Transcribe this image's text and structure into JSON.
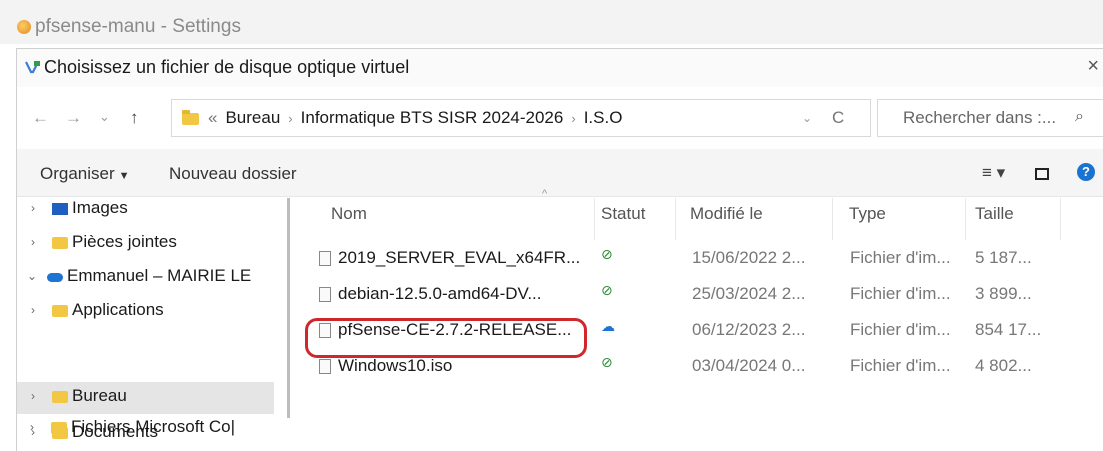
{
  "background_window": {
    "title": "pfsense-manu - Settings",
    "icon": "virtualbox-icon"
  },
  "dialog": {
    "title": "Choisissez un fichier de disque optique virtuel",
    "close": "×"
  },
  "navigation": {
    "back": "←",
    "forward": "→",
    "recent": "⌄",
    "up": "↑"
  },
  "address": {
    "overflow": "«",
    "crumbs": [
      "Bureau",
      "Informatique BTS SISR 2024-2026",
      "I.S.O"
    ],
    "separator": "›",
    "dropdown": "⌄",
    "refresh": "C"
  },
  "search": {
    "placeholder": "Rechercher dans :...",
    "icon": "search-icon"
  },
  "toolbar": {
    "organize": "Organiser",
    "new_folder": "Nouveau dossier",
    "view": "≡ ▾",
    "help": "?"
  },
  "nav_pane": {
    "items": [
      {
        "label": "Images",
        "chevron": "›",
        "icon": "images-icon"
      },
      {
        "label": "Pièces jointes",
        "chevron": "›",
        "icon": "folder-icon"
      },
      {
        "label": "Emmanuel – MAIRIE LE",
        "chevron": "⌄",
        "icon": "cloud-icon"
      },
      {
        "label": "Applications",
        "chevron": "›",
        "icon": "folder-icon"
      },
      {
        "label": "Bureau",
        "chevron": "›",
        "icon": "folder-icon",
        "selected": true
      },
      {
        "label": "Documents",
        "chevron": "›",
        "icon": "folder-icon"
      },
      {
        "label": "Fichiers Microsoft Co|",
        "chevron": "›",
        "icon": "folder-icon"
      }
    ]
  },
  "file_list": {
    "columns": {
      "name": "Nom",
      "status": "Statut",
      "modified": "Modifié le",
      "type": "Type",
      "size": "Taille"
    },
    "rows": [
      {
        "name": "2019_SERVER_EVAL_x64FR...",
        "status": "⊘",
        "status_kind": "synced",
        "date": "15/06/2022 2...",
        "type": "Fichier d'im...",
        "size": "5 187..."
      },
      {
        "name": "debian-12.5.0-amd64-DV...",
        "status": "⊘",
        "status_kind": "synced",
        "date": "25/03/2024 2...",
        "type": "Fichier d'im...",
        "size": "3 899..."
      },
      {
        "name": "pfSense-CE-2.7.2-RELEASE...",
        "status": "☁",
        "status_kind": "cloud",
        "date": "06/12/2023 2...",
        "type": "Fichier d'im...",
        "size": "854 17...",
        "highlighted": true
      },
      {
        "name": "Windows10.iso",
        "status": "⊘",
        "status_kind": "synced",
        "date": "03/04/2024 0...",
        "type": "Fichier d'im...",
        "size": "4 802..."
      }
    ]
  },
  "colors": {
    "highlight": "#d0272f",
    "folder": "#f2c744",
    "accent": "#1a73d1",
    "status_ok": "#2e8b3a"
  }
}
